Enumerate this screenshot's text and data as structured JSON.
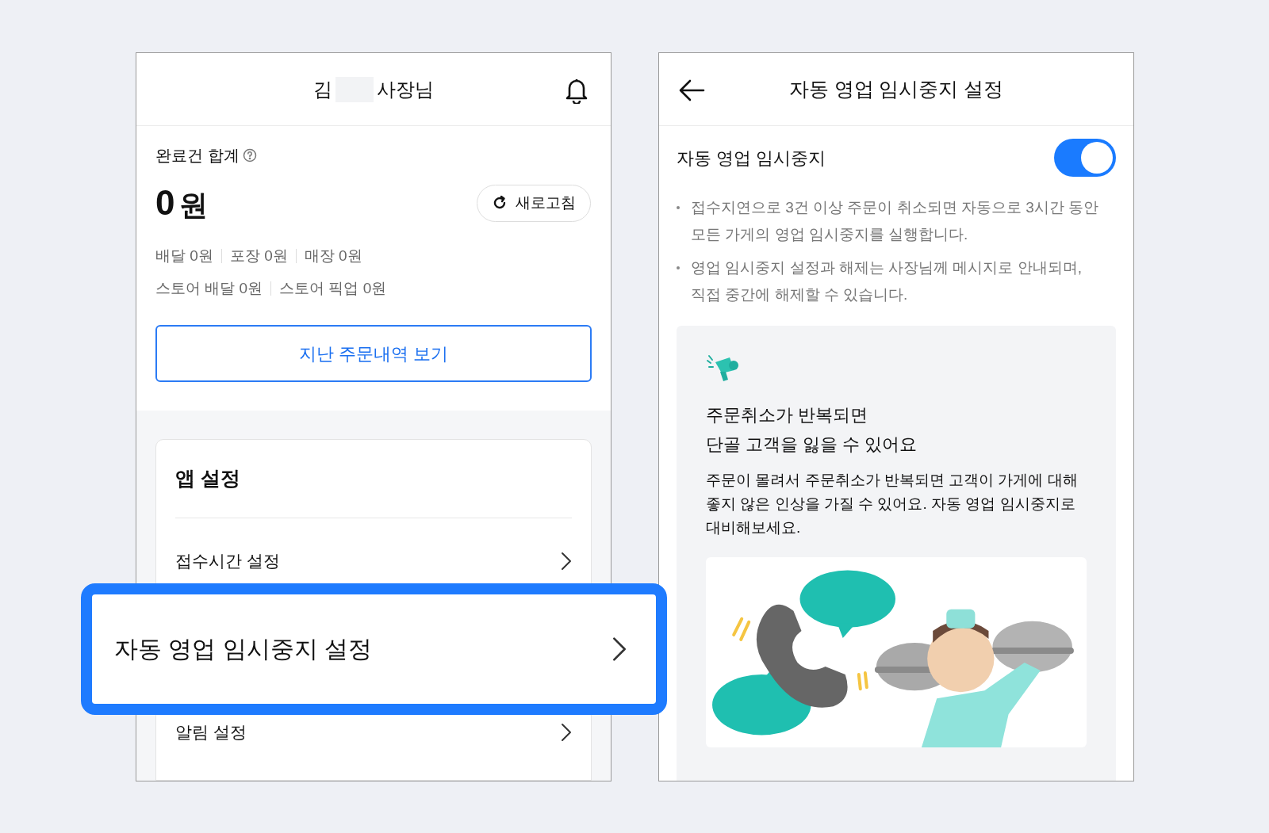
{
  "home_screen": {
    "header": {
      "name_first": "김",
      "name_suffix": "사장님"
    },
    "summary": {
      "title": "완료건 합계",
      "amount": "0",
      "unit": "원",
      "refresh_button": "새로고침",
      "breakdown_rows": [
        [
          "배달 0원",
          "포장 0원",
          "매장 0원"
        ],
        [
          "스토어 배달 0원",
          "스토어 픽업 0원"
        ]
      ]
    },
    "history_button": "지난 주문내역 보기",
    "app_settings": {
      "title": "앱 설정",
      "items": [
        {
          "label": "접수시간 설정"
        },
        {
          "kind": "highlight",
          "label": "자동 영업 임시중지 설정"
        },
        {
          "label": "알림 설정"
        }
      ]
    }
  },
  "settings_screen": {
    "header": {
      "title": "자동 영업 임시중지 설정"
    },
    "toggle": {
      "label": "자동 영업 임시중지",
      "on": true
    },
    "notes": [
      "접수지연으로 3건 이상 주문이 취소되면 자동으로 3시간 동안 모든 가게의 영업 임시중지를 실행합니다.",
      "영업 임시중지 설정과 해제는 사장님께 메시지로 안내되며, 직접 중간에 해제할 수 있습니다."
    ],
    "info_card": {
      "heading_lines": [
        "주문취소가 반복되면",
        "단골 고객을 잃을 수 있어요"
      ],
      "body": "주문이 몰려서 주문취소가 반복되면 고객이 가게에 대해 좋지 않은 인상을 가질 수 있어요. 자동 영업 임시중지로 대비해보세요.",
      "illustration": {
        "kind": "picture"
      }
    }
  }
}
